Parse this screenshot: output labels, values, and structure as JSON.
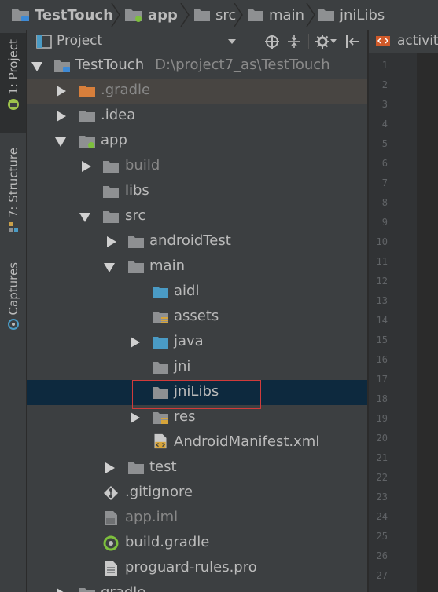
{
  "breadcrumb": {
    "items": [
      "TestTouch",
      "app",
      "src",
      "main",
      "jniLibs"
    ]
  },
  "stripe": {
    "project": "1: Project",
    "structure": "7: Structure",
    "captures": "Captures"
  },
  "panel": {
    "title": "Project",
    "view_mode_icon": "chevron-down-icon"
  },
  "tree": {
    "root": {
      "label": "TestTouch",
      "path": "D:\\project7_as\\TestTouch"
    },
    "gradle_hidden": ".gradle",
    "idea": ".idea",
    "app": "app",
    "build": "build",
    "libs": "libs",
    "src": "src",
    "androidTest": "androidTest",
    "main": "main",
    "aidl": "aidl",
    "assets": "assets",
    "java": "java",
    "jni": "jni",
    "jniLibs": "jniLibs",
    "res": "res",
    "manifest": "AndroidManifest.xml",
    "test": "test",
    "gitignore": ".gitignore",
    "appiml": "app.iml",
    "buildgradle": "build.gradle",
    "proguard": "proguard-rules.pro",
    "gradle_partial": "gradle"
  },
  "editor": {
    "tab_label": "activit",
    "line_numbers": [
      "1",
      "2",
      "3",
      "4",
      "5",
      "6",
      "7",
      "8",
      "9",
      "10",
      "11",
      "12",
      "13",
      "14",
      "15",
      "16",
      "17",
      "18",
      "19",
      "20",
      "21",
      "22",
      "23",
      "24",
      "25",
      "26",
      "27"
    ]
  },
  "colors": {
    "panel_bg": "#3c3f41",
    "selection": "#0d293e",
    "folder": "#8e9092",
    "source_folder": "#4a9bc5",
    "excluded_folder": "#d87f3b",
    "highlight_box": "#d03b3b"
  }
}
